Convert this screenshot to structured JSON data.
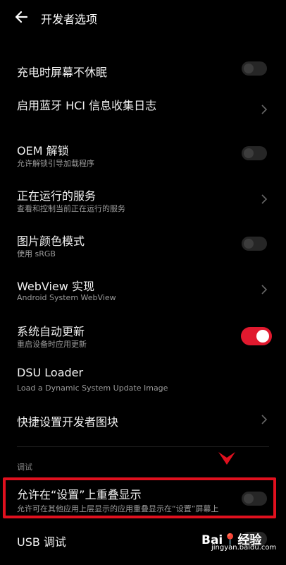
{
  "header": {
    "title": "开发者选项"
  },
  "rows": [
    {
      "title": "充电时屏幕不休眠",
      "control": "toggle-off"
    },
    {
      "title": "启用蓝牙 HCI 信息收集日志",
      "control": "chevron"
    },
    {
      "title": "OEM 解锁",
      "subtitle": "允许解锁引导加载程序",
      "control": "toggle-off"
    },
    {
      "title": "正在运行的服务",
      "subtitle": "查看和控制当前正在运行的服务",
      "control": "chevron"
    },
    {
      "title": "图片颜色模式",
      "subtitle": "使用 sRGB",
      "control": "toggle-off"
    },
    {
      "title": "WebView 实现",
      "subtitle": "Android System WebView",
      "control": "chevron"
    },
    {
      "title": "系统自动更新",
      "subtitle": "重启设备时应用更新",
      "control": "toggle-on"
    },
    {
      "title": "DSU Loader",
      "subtitle": "Load a Dynamic System Update Image",
      "control": "none"
    },
    {
      "title": "快捷设置开发者图块",
      "control": "chevron"
    }
  ],
  "section": {
    "label": "调试"
  },
  "overlay_row": {
    "title": "允许在“设置”上重叠显示",
    "subtitle": "允许可在其他应用上层显示的应用重叠显示在“设置”屏幕上",
    "control": "toggle-off"
  },
  "usb_row": {
    "title": "USB 调试"
  },
  "watermark": {
    "logo": "Bai📍经验",
    "url": "jingyan.baidu.com"
  },
  "colors": {
    "accent": "#e0192e",
    "highlight": "#e0101e",
    "background": "#000000"
  },
  "icons": {
    "back": "arrow-left-icon",
    "chevron": "chevron-right-icon",
    "marker": "down-triangle-icon"
  }
}
